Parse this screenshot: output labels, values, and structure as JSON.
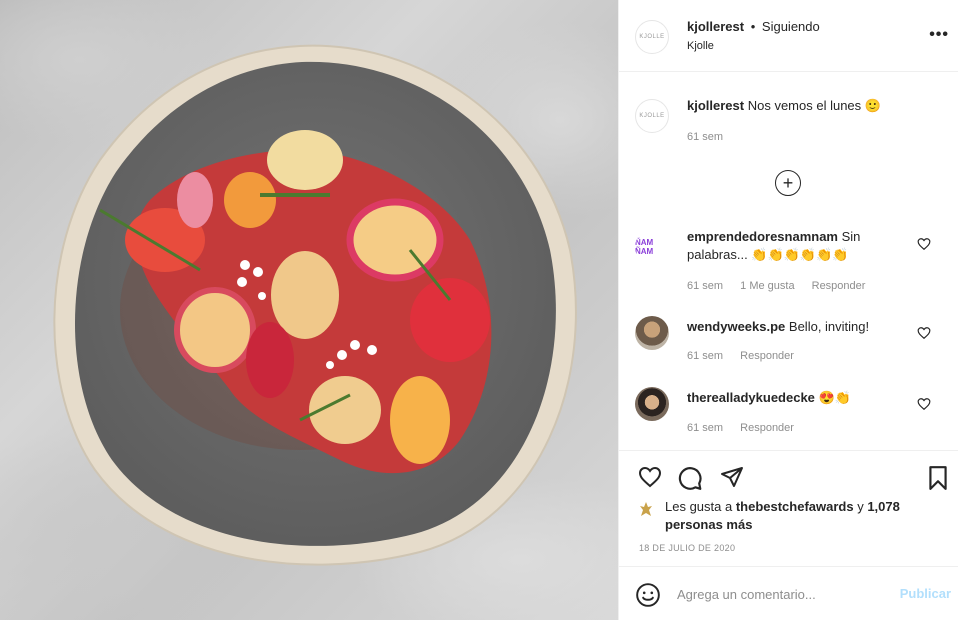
{
  "post": {
    "username": "kjollerest",
    "separator": "•",
    "follow_status": "Siguiendo",
    "location": "Kjolle",
    "avatar_text": "KJOLLE",
    "more_icon": "more-horizontal-icon"
  },
  "caption": {
    "username": "kjollerest",
    "text": "Nos vemos el lunes 🙂",
    "time": "61 sem"
  },
  "load_more_icon": "plus-circle-icon",
  "comments": [
    {
      "username": "emprendedoresnamnam",
      "text": "Sin palabras... 👏👏👏👏👏👏",
      "time": "61 sem",
      "likes": "1 Me gusta",
      "reply": "Responder",
      "avatar_text": "ÑAM ÑAM",
      "avatar_color": "#8b3fd9"
    },
    {
      "username": "wendyweeks.pe",
      "text": "Bello, inviting!",
      "time": "61 sem",
      "reply": "Responder"
    },
    {
      "username": "therealladykuedecke",
      "text": "😍👏",
      "time": "61 sem",
      "reply": "Responder"
    }
  ],
  "actions": {
    "like_icon": "heart-icon",
    "comment_icon": "comment-icon",
    "share_icon": "send-icon",
    "save_icon": "bookmark-icon"
  },
  "likes": {
    "prefix": "Les gusta a ",
    "user": "thebestchefawards",
    "middle": " y ",
    "count": "1,078 personas más"
  },
  "date": "18 DE JULIO DE 2020",
  "comment_box": {
    "placeholder": "Agrega un comentario...",
    "publish": "Publicar",
    "emoji_icon": "smiley-icon"
  },
  "colors": {
    "text": "#262626",
    "muted": "#8e8e8e",
    "publish_disabled": "#b2dffc",
    "border": "#efefef"
  }
}
